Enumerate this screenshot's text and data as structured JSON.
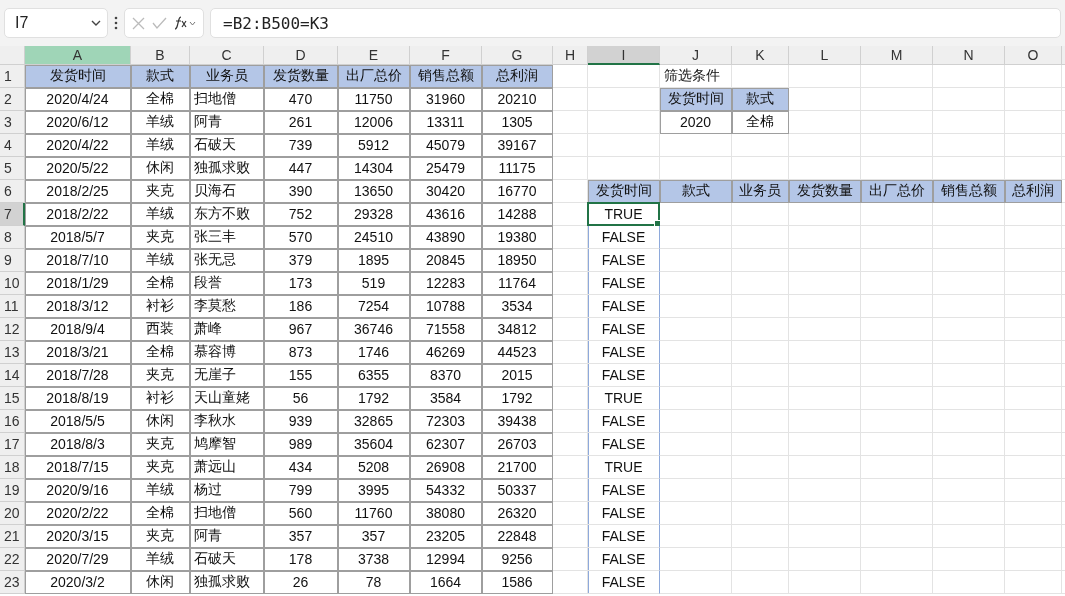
{
  "name_box": {
    "value": "I7"
  },
  "formula_bar": {
    "value": "=B2:B500=K3"
  },
  "column_headers": [
    {
      "label": "A",
      "selected": false,
      "highlighted": true
    },
    {
      "label": "B",
      "selected": false,
      "highlighted": false
    },
    {
      "label": "C",
      "selected": false,
      "highlighted": false
    },
    {
      "label": "D",
      "selected": false,
      "highlighted": false
    },
    {
      "label": "E",
      "selected": false,
      "highlighted": false
    },
    {
      "label": "F",
      "selected": false,
      "highlighted": false
    },
    {
      "label": "G",
      "selected": false,
      "highlighted": false
    },
    {
      "label": "H",
      "selected": false,
      "highlighted": false
    },
    {
      "label": "I",
      "selected": true,
      "highlighted": false
    },
    {
      "label": "J",
      "selected": false,
      "highlighted": false
    },
    {
      "label": "K",
      "selected": false,
      "highlighted": false
    },
    {
      "label": "L",
      "selected": false,
      "highlighted": false
    },
    {
      "label": "M",
      "selected": false,
      "highlighted": false
    },
    {
      "label": "N",
      "selected": false,
      "highlighted": false
    },
    {
      "label": "O",
      "selected": false,
      "highlighted": false
    }
  ],
  "row_headers": [
    {
      "label": "1",
      "selected": false
    },
    {
      "label": "2",
      "selected": false
    },
    {
      "label": "3",
      "selected": false
    },
    {
      "label": "4",
      "selected": false
    },
    {
      "label": "5",
      "selected": false
    },
    {
      "label": "6",
      "selected": false
    },
    {
      "label": "7",
      "selected": true
    },
    {
      "label": "8",
      "selected": false
    },
    {
      "label": "9",
      "selected": false
    },
    {
      "label": "10",
      "selected": false
    },
    {
      "label": "11",
      "selected": false
    },
    {
      "label": "12",
      "selected": false
    },
    {
      "label": "13",
      "selected": false
    },
    {
      "label": "14",
      "selected": false
    },
    {
      "label": "15",
      "selected": false
    },
    {
      "label": "16",
      "selected": false
    },
    {
      "label": "17",
      "selected": false
    },
    {
      "label": "18",
      "selected": false
    },
    {
      "label": "19",
      "selected": false
    },
    {
      "label": "20",
      "selected": false
    },
    {
      "label": "21",
      "selected": false
    },
    {
      "label": "22",
      "selected": false
    },
    {
      "label": "23",
      "selected": false
    }
  ],
  "data_table": {
    "columns": [
      "发货时间",
      "款式",
      "业务员",
      "发货数量",
      "出厂总价",
      "销售总额",
      "总利润"
    ],
    "rows": [
      [
        "2020/4/24",
        "全棉",
        "扫地僧",
        "470",
        "11750",
        "31960",
        "20210"
      ],
      [
        "2020/6/12",
        "羊绒",
        "阿青",
        "261",
        "12006",
        "13311",
        "1305"
      ],
      [
        "2020/4/22",
        "羊绒",
        "石破天",
        "739",
        "5912",
        "45079",
        "39167"
      ],
      [
        "2020/5/22",
        "休闲",
        "独孤求败",
        "447",
        "14304",
        "25479",
        "11175"
      ],
      [
        "2018/2/25",
        "夹克",
        "贝海石",
        "390",
        "13650",
        "30420",
        "16770"
      ],
      [
        "2018/2/22",
        "羊绒",
        "东方不败",
        "752",
        "29328",
        "43616",
        "14288"
      ],
      [
        "2018/5/7",
        "夹克",
        "张三丰",
        "570",
        "24510",
        "43890",
        "19380"
      ],
      [
        "2018/7/10",
        "羊绒",
        "张无忌",
        "379",
        "1895",
        "20845",
        "18950"
      ],
      [
        "2018/1/29",
        "全棉",
        "段誉",
        "173",
        "519",
        "12283",
        "11764"
      ],
      [
        "2018/3/12",
        "衬衫",
        "李莫愁",
        "186",
        "7254",
        "10788",
        "3534"
      ],
      [
        "2018/9/4",
        "西装",
        "萧峰",
        "967",
        "36746",
        "71558",
        "34812"
      ],
      [
        "2018/3/21",
        "全棉",
        "慕容博",
        "873",
        "1746",
        "46269",
        "44523"
      ],
      [
        "2018/7/28",
        "夹克",
        "无崖子",
        "155",
        "6355",
        "8370",
        "2015"
      ],
      [
        "2018/8/19",
        "衬衫",
        "天山童姥",
        "56",
        "1792",
        "3584",
        "1792"
      ],
      [
        "2018/5/5",
        "休闲",
        "李秋水",
        "939",
        "32865",
        "72303",
        "39438"
      ],
      [
        "2018/8/3",
        "夹克",
        "鸠摩智",
        "989",
        "35604",
        "62307",
        "26703"
      ],
      [
        "2018/7/15",
        "夹克",
        "萧远山",
        "434",
        "5208",
        "26908",
        "21700"
      ],
      [
        "2020/9/16",
        "羊绒",
        "杨过",
        "799",
        "3995",
        "54332",
        "50337"
      ],
      [
        "2020/2/22",
        "全棉",
        "扫地僧",
        "560",
        "11760",
        "38080",
        "26320"
      ],
      [
        "2020/3/15",
        "夹克",
        "阿青",
        "357",
        "357",
        "23205",
        "22848"
      ],
      [
        "2020/7/29",
        "羊绒",
        "石破天",
        "178",
        "3738",
        "12994",
        "9256"
      ],
      [
        "2020/3/2",
        "休闲",
        "独孤求败",
        "26",
        "78",
        "1664",
        "1586"
      ]
    ]
  },
  "criteria": {
    "title": "筛选条件",
    "columns": [
      "发货时间",
      "款式"
    ],
    "values": [
      "2020",
      "全棉"
    ]
  },
  "result": {
    "columns": [
      "发货时间",
      "款式",
      "业务员",
      "发货数量",
      "出厂总价",
      "销售总额",
      "总利润"
    ],
    "values": [
      {
        "text": "TRUE",
        "selected": true
      },
      {
        "text": "FALSE",
        "selected": false
      },
      {
        "text": "FALSE",
        "selected": false
      },
      {
        "text": "FALSE",
        "selected": false
      },
      {
        "text": "FALSE",
        "selected": false
      },
      {
        "text": "FALSE",
        "selected": false
      },
      {
        "text": "FALSE",
        "selected": false
      },
      {
        "text": "FALSE",
        "selected": false
      },
      {
        "text": "TRUE",
        "selected": false
      },
      {
        "text": "FALSE",
        "selected": false
      },
      {
        "text": "FALSE",
        "selected": false
      },
      {
        "text": "TRUE",
        "selected": false
      },
      {
        "text": "FALSE",
        "selected": false
      },
      {
        "text": "FALSE",
        "selected": false
      },
      {
        "text": "FALSE",
        "selected": false
      },
      {
        "text": "FALSE",
        "selected": false
      },
      {
        "text": "FALSE",
        "selected": false
      }
    ]
  }
}
